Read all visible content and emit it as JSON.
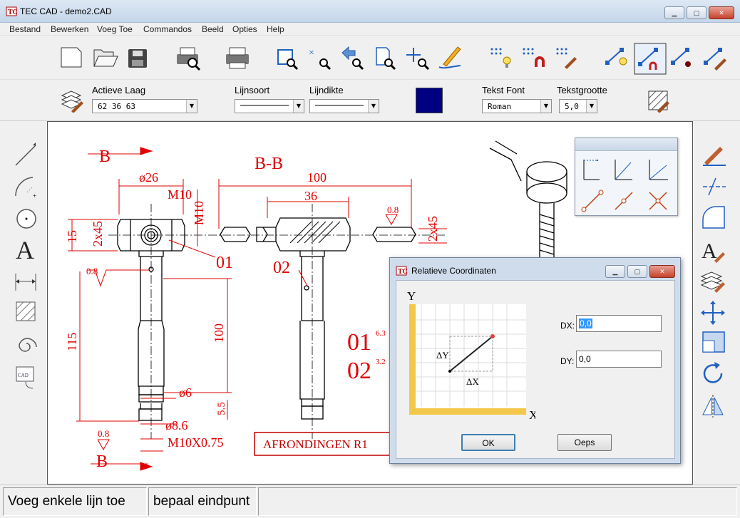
{
  "window": {
    "title": "TEC CAD - demo2.CAD",
    "minimize_label": "▁",
    "maximize_label": "▢",
    "close_label": "✕"
  },
  "menu": [
    "Bestand",
    "Bewerken",
    "Voeg Toe",
    "Commandos",
    "Beeld",
    "Opties",
    "Help"
  ],
  "toolbar2": {
    "laag_label": "Actieve Laag",
    "laag_value": "62 36 63",
    "lijnsoort_label": "Lijnsoort",
    "lijndikte_label": "Lijndikte",
    "color": "#000080",
    "font_label": "Tekst Font",
    "font_value": "Roman",
    "size_label": "Tekstgrootte",
    "size_value": "5,0"
  },
  "drawing": {
    "section_title": "B-B",
    "label_b_top": "B",
    "label_b_bottom": "B",
    "dims": [
      "ø26",
      "100",
      "M10",
      "36",
      "M10",
      "0.8",
      "2x45",
      "15",
      "2x45",
      "01",
      "02",
      "0.8",
      "115",
      "100",
      "ø6",
      "5.5",
      "ø8.6",
      "M10X0.75",
      "0.8"
    ],
    "finish1": "01",
    "finish1_val": "6.3",
    "finish2": "02",
    "finish2_val": "3.2",
    "note": "AFRONDINGEN R1"
  },
  "dialog": {
    "title": "Relatieve Coordinaten",
    "axis_y": "Y",
    "axis_x": "X",
    "delta_y": "ΔY",
    "delta_x": "ΔX",
    "dx_label": "DX:",
    "dx_value": "0,0",
    "dy_label": "DY:",
    "dy_value": "0,0",
    "ok_label": "OK",
    "cancel_label": "Oeps"
  },
  "status": {
    "left": "Voeg enkele lijn toe",
    "right": "bepaal eindpunt"
  },
  "colors": {
    "drawing": "#e00000",
    "accent": "#000080"
  }
}
